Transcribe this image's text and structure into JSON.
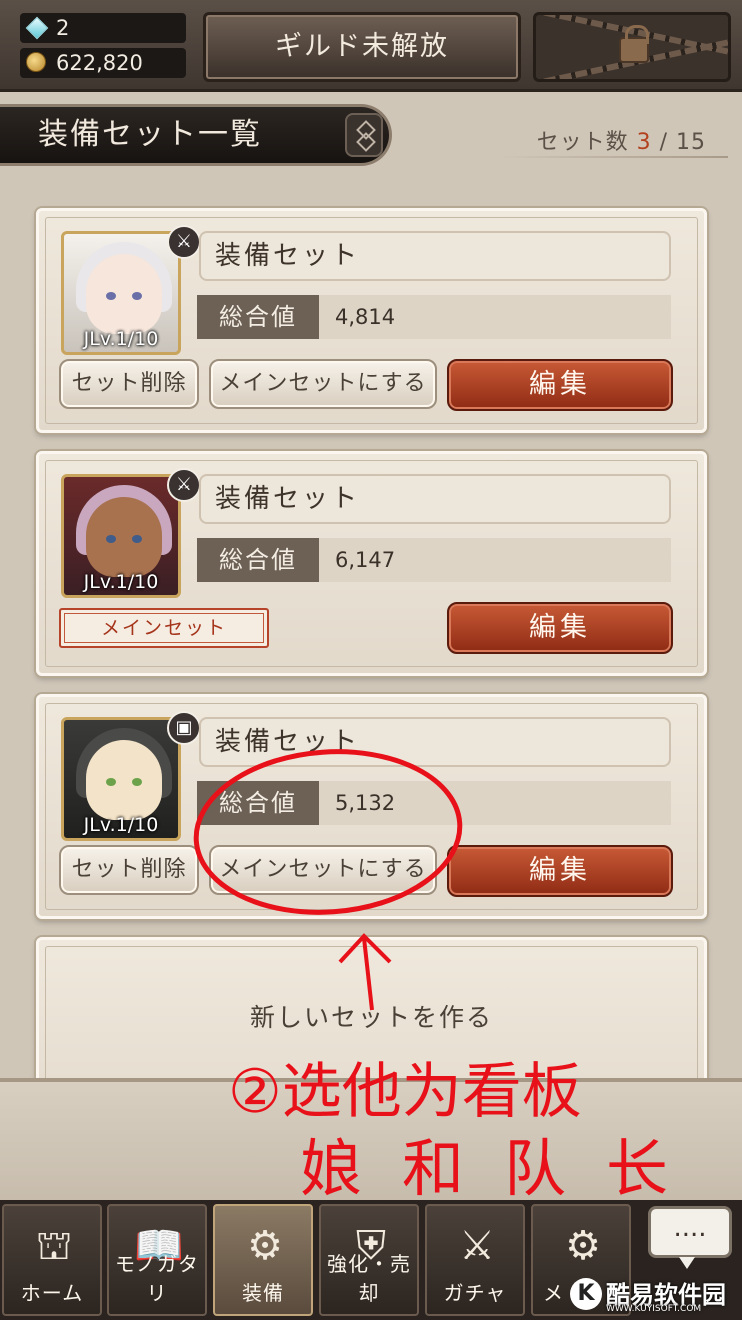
{
  "status": {
    "gems": "2",
    "gold": "622,820",
    "guild_button": "ギルド未解放"
  },
  "header": {
    "title": "装備セット一覧",
    "count_label": "セット数",
    "count_current": "3",
    "count_separator": "/",
    "count_max": "15"
  },
  "sets": [
    {
      "jlv": "JLv.1/10",
      "weapon_icon": "sword-icon",
      "name": "装備セット",
      "total_label": "総合値",
      "total_value": "4,814",
      "delete_label": "セット削除",
      "make_main_label": "メインセットにする",
      "edit_label": "編集",
      "is_main": false
    },
    {
      "jlv": "JLv.1/10",
      "weapon_icon": "sword-icon",
      "name": "装備セット",
      "total_label": "総合値",
      "total_value": "6,147",
      "main_badge": "メインセット",
      "edit_label": "編集",
      "is_main": true
    },
    {
      "jlv": "JLv.1/10",
      "weapon_icon": "tome-icon",
      "name": "装備セット",
      "total_label": "総合値",
      "total_value": "5,132",
      "delete_label": "セット削除",
      "make_main_label": "メインセットにする",
      "edit_label": "編集",
      "is_main": false
    }
  ],
  "new_set_label": "新しいセットを作る",
  "annotation": {
    "line1": "②选他为看板",
    "line2": "娘和队长",
    "color": "#e8111a"
  },
  "tabs": [
    {
      "label": "ホーム",
      "icon": "castle-icon"
    },
    {
      "label": "モノガタリ",
      "icon": "book-icon"
    },
    {
      "label": "装備",
      "icon": "equipment-icon",
      "active": true
    },
    {
      "label": "強化・売却",
      "icon": "helmet-icon"
    },
    {
      "label": "ガチャ",
      "icon": "crossed-swords-icon"
    },
    {
      "label": "メ",
      "icon": "gears-icon"
    }
  ],
  "chat_button": "....",
  "watermark": {
    "mark": "K",
    "text": "酷易软件园",
    "sub": "WWW.KUYISOFT.COM"
  },
  "colors": {
    "accent_red": "#b3411d",
    "edit_button": "#b0442a",
    "panel": "#cfc6b8"
  }
}
